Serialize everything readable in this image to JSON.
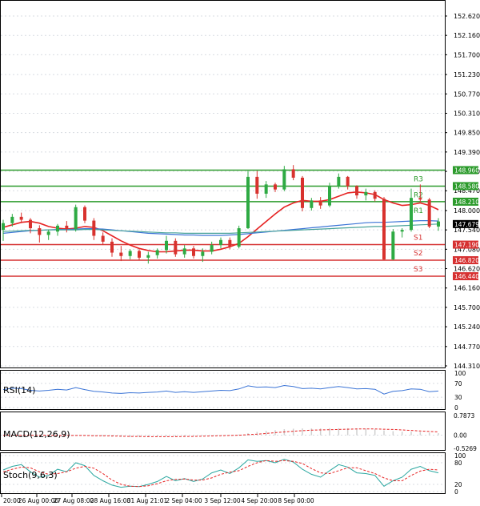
{
  "colors": {
    "bull": "#2eaa43",
    "bear": "#d8322e",
    "resistance": "#2c9b2c",
    "support": "#d63131",
    "ma_fast": "#e62222",
    "ma_mid": "#3b74d6",
    "ma_slow": "#49a39a",
    "rsi": "#3b74d6",
    "macd_signal": "#e62222",
    "macd_hist": "#cfcfcf",
    "stoch_k": "#2aa7a0",
    "stoch_d": "#e62222",
    "grid": "#d7dbe1",
    "price_tag_bg": "#000000",
    "price_tag_fg": "#ffffff"
  },
  "chart_data": [
    {
      "type": "candlestick",
      "ylim": [
        144.31,
        152.62
      ],
      "yticks": [
        "152.620",
        "152.160",
        "151.700",
        "151.230",
        "150.770",
        "150.310",
        "149.850",
        "149.390",
        "148.930",
        "148.470",
        "148.000",
        "147.540",
        "147.080",
        "146.620",
        "146.160",
        "145.700",
        "145.240",
        "144.770",
        "144.310"
      ],
      "xticks": [
        "20:00",
        "26 Aug 00:00",
        "27 Aug 08:00",
        "28 Aug 16:00",
        "31 Aug 21:01",
        "2 Sep 04:00",
        "3 Sep 12:00",
        "4 Sep 20:00",
        "8 Sep 00:00"
      ],
      "current_price": "147.679",
      "candles": [
        {
          "o": 147.54,
          "h": 147.78,
          "l": 147.28,
          "c": 147.7
        },
        {
          "o": 147.7,
          "h": 147.92,
          "l": 147.62,
          "c": 147.85
        },
        {
          "o": 147.85,
          "h": 147.95,
          "l": 147.7,
          "c": 147.78
        },
        {
          "o": 147.78,
          "h": 147.82,
          "l": 147.46,
          "c": 147.58
        },
        {
          "o": 147.58,
          "h": 147.65,
          "l": 147.24,
          "c": 147.42
        },
        {
          "o": 147.42,
          "h": 147.55,
          "l": 147.3,
          "c": 147.5
        },
        {
          "o": 147.5,
          "h": 147.68,
          "l": 147.4,
          "c": 147.64
        },
        {
          "o": 147.64,
          "h": 147.75,
          "l": 147.48,
          "c": 147.56
        },
        {
          "o": 147.56,
          "h": 148.14,
          "l": 147.5,
          "c": 148.08
        },
        {
          "o": 148.08,
          "h": 148.12,
          "l": 147.7,
          "c": 147.76
        },
        {
          "o": 147.76,
          "h": 147.82,
          "l": 147.3,
          "c": 147.4
        },
        {
          "o": 147.4,
          "h": 147.48,
          "l": 147.18,
          "c": 147.26
        },
        {
          "o": 147.26,
          "h": 147.34,
          "l": 146.9,
          "c": 147.0
        },
        {
          "o": 147.0,
          "h": 147.16,
          "l": 146.8,
          "c": 146.92
        },
        {
          "o": 146.92,
          "h": 147.08,
          "l": 146.84,
          "c": 147.04
        },
        {
          "o": 147.04,
          "h": 147.08,
          "l": 146.82,
          "c": 146.88
        },
        {
          "o": 146.88,
          "h": 147.02,
          "l": 146.74,
          "c": 146.94
        },
        {
          "o": 146.94,
          "h": 147.1,
          "l": 146.86,
          "c": 147.06
        },
        {
          "o": 147.06,
          "h": 147.4,
          "l": 146.98,
          "c": 147.28
        },
        {
          "o": 147.28,
          "h": 147.34,
          "l": 146.9,
          "c": 146.96
        },
        {
          "o": 146.96,
          "h": 147.18,
          "l": 146.88,
          "c": 147.1
        },
        {
          "o": 147.1,
          "h": 147.16,
          "l": 146.86,
          "c": 146.92
        },
        {
          "o": 146.92,
          "h": 147.1,
          "l": 146.78,
          "c": 147.02
        },
        {
          "o": 147.02,
          "h": 147.26,
          "l": 146.96,
          "c": 147.18
        },
        {
          "o": 147.18,
          "h": 147.36,
          "l": 147.1,
          "c": 147.3
        },
        {
          "o": 147.3,
          "h": 147.36,
          "l": 147.08,
          "c": 147.14
        },
        {
          "o": 147.14,
          "h": 147.64,
          "l": 147.1,
          "c": 147.58
        },
        {
          "o": 147.58,
          "h": 148.94,
          "l": 147.56,
          "c": 148.8
        },
        {
          "o": 148.8,
          "h": 148.94,
          "l": 148.28,
          "c": 148.4
        },
        {
          "o": 148.4,
          "h": 148.7,
          "l": 148.3,
          "c": 148.62
        },
        {
          "o": 148.62,
          "h": 148.66,
          "l": 148.44,
          "c": 148.5
        },
        {
          "o": 148.5,
          "h": 149.06,
          "l": 148.46,
          "c": 148.98
        },
        {
          "o": 148.98,
          "h": 149.08,
          "l": 148.72,
          "c": 148.78
        },
        {
          "o": 148.78,
          "h": 148.82,
          "l": 147.98,
          "c": 148.06
        },
        {
          "o": 148.06,
          "h": 148.3,
          "l": 148.0,
          "c": 148.24
        },
        {
          "o": 148.24,
          "h": 148.32,
          "l": 148.04,
          "c": 148.12
        },
        {
          "o": 148.12,
          "h": 148.66,
          "l": 148.08,
          "c": 148.58
        },
        {
          "o": 148.58,
          "h": 148.88,
          "l": 148.52,
          "c": 148.8
        },
        {
          "o": 148.8,
          "h": 148.82,
          "l": 148.5,
          "c": 148.58
        },
        {
          "o": 148.58,
          "h": 148.6,
          "l": 148.28,
          "c": 148.36
        },
        {
          "o": 148.36,
          "h": 148.52,
          "l": 148.24,
          "c": 148.44
        },
        {
          "o": 148.44,
          "h": 148.48,
          "l": 148.22,
          "c": 148.28
        },
        {
          "o": 148.28,
          "h": 148.32,
          "l": 146.82,
          "c": 146.84
        },
        {
          "o": 146.84,
          "h": 147.56,
          "l": 146.82,
          "c": 147.5
        },
        {
          "o": 147.5,
          "h": 147.58,
          "l": 147.36,
          "c": 147.54
        },
        {
          "o": 147.54,
          "h": 148.52,
          "l": 147.5,
          "c": 148.3
        },
        {
          "o": 148.3,
          "h": 148.62,
          "l": 148.2,
          "c": 148.26
        },
        {
          "o": 148.26,
          "h": 148.3,
          "l": 147.58,
          "c": 147.62
        },
        {
          "o": 147.62,
          "h": 147.82,
          "l": 147.52,
          "c": 147.74
        }
      ],
      "levels": [
        {
          "name": "R3",
          "value": 148.96,
          "kind": "resistance",
          "tag": "148.960"
        },
        {
          "name": "R2",
          "value": 148.58,
          "kind": "resistance",
          "tag": "148.580"
        },
        {
          "name": "R1",
          "value": 148.21,
          "kind": "resistance",
          "tag": "148.210"
        },
        {
          "name": "S1",
          "value": 147.19,
          "kind": "support",
          "tag": "147.190"
        },
        {
          "name": "S2",
          "value": 146.82,
          "kind": "support",
          "tag": "146.820"
        },
        {
          "name": "S3",
          "value": 146.44,
          "kind": "support",
          "tag": "146.440"
        }
      ],
      "moving_averages": [
        {
          "color_key": "ma_fast",
          "values": [
            147.6,
            147.66,
            147.72,
            147.74,
            147.7,
            147.62,
            147.58,
            147.56,
            147.58,
            147.62,
            147.6,
            147.52,
            147.4,
            147.28,
            147.18,
            147.1,
            147.05,
            147.02,
            147.02,
            147.04,
            147.06,
            147.06,
            147.04,
            147.04,
            147.08,
            147.14,
            147.22,
            147.38,
            147.56,
            147.74,
            147.92,
            148.08,
            148.18,
            148.24,
            148.22,
            148.22,
            148.26,
            148.34,
            148.42,
            148.44,
            148.42,
            148.38,
            148.26,
            148.18,
            148.12,
            148.14,
            148.18,
            148.12,
            148.02
          ]
        },
        {
          "color_key": "ma_mid",
          "values": [
            147.46,
            147.48,
            147.5,
            147.52,
            147.53,
            147.54,
            147.55,
            147.55,
            147.56,
            147.57,
            147.57,
            147.56,
            147.54,
            147.52,
            147.5,
            147.48,
            147.46,
            147.45,
            147.44,
            147.43,
            147.42,
            147.42,
            147.41,
            147.41,
            147.41,
            147.42,
            147.43,
            147.45,
            147.47,
            147.49,
            147.51,
            147.53,
            147.55,
            147.57,
            147.59,
            147.61,
            147.63,
            147.65,
            147.67,
            147.69,
            147.71,
            147.72,
            147.72,
            147.73,
            147.74,
            147.75,
            147.76,
            147.76,
            147.75
          ]
        },
        {
          "color_key": "ma_slow",
          "values": [
            147.5,
            147.51,
            147.52,
            147.53,
            147.53,
            147.54,
            147.54,
            147.54,
            147.54,
            147.55,
            147.55,
            147.54,
            147.53,
            147.52,
            147.51,
            147.5,
            147.49,
            147.48,
            147.47,
            147.47,
            147.46,
            147.46,
            147.46,
            147.46,
            147.46,
            147.46,
            147.47,
            147.48,
            147.49,
            147.5,
            147.51,
            147.52,
            147.53,
            147.54,
            147.55,
            147.56,
            147.57,
            147.58,
            147.59,
            147.6,
            147.61,
            147.62,
            147.62,
            147.63,
            147.64,
            147.65,
            147.66,
            147.67,
            147.68
          ]
        }
      ]
    },
    {
      "type": "line",
      "title": "RSI(14)",
      "ylim": [
        0,
        100
      ],
      "yticks": [
        "100",
        "70",
        "30",
        "0"
      ],
      "values": [
        52,
        56,
        55,
        50,
        48,
        50,
        53,
        51,
        58,
        52,
        47,
        45,
        42,
        41,
        43,
        42,
        44,
        45,
        48,
        44,
        46,
        44,
        46,
        48,
        50,
        49,
        54,
        63,
        59,
        60,
        58,
        64,
        61,
        55,
        56,
        54,
        58,
        61,
        58,
        54,
        55,
        53,
        39,
        47,
        49,
        54,
        53,
        46,
        48
      ]
    },
    {
      "type": "bar",
      "title": "MACD(12,26,9)",
      "ylim": [
        -0.5269,
        0.7873
      ],
      "yticks": [
        "0.7873",
        "0.00",
        "-0.5269"
      ],
      "histogram": [
        0.0,
        0.0,
        0.01,
        0.01,
        0.0,
        -0.01,
        -0.02,
        -0.02,
        -0.01,
        -0.02,
        -0.03,
        -0.04,
        -0.06,
        -0.07,
        -0.08,
        -0.08,
        -0.07,
        -0.06,
        -0.05,
        -0.05,
        -0.04,
        -0.03,
        -0.02,
        -0.01,
        0.0,
        0.01,
        0.03,
        0.08,
        0.13,
        0.17,
        0.2,
        0.24,
        0.26,
        0.27,
        0.27,
        0.27,
        0.28,
        0.28,
        0.28,
        0.27,
        0.26,
        0.24,
        0.19,
        0.16,
        0.14,
        0.14,
        0.13,
        0.1,
        0.08
      ],
      "signal": [
        0.0,
        0.0,
        0.0,
        0.0,
        0.0,
        0.0,
        -0.01,
        -0.01,
        -0.01,
        -0.01,
        -0.02,
        -0.02,
        -0.03,
        -0.04,
        -0.05,
        -0.05,
        -0.06,
        -0.06,
        -0.06,
        -0.06,
        -0.05,
        -0.05,
        -0.04,
        -0.03,
        -0.02,
        -0.01,
        0.0,
        0.02,
        0.04,
        0.07,
        0.1,
        0.13,
        0.16,
        0.18,
        0.2,
        0.21,
        0.22,
        0.23,
        0.24,
        0.25,
        0.25,
        0.25,
        0.24,
        0.23,
        0.21,
        0.19,
        0.17,
        0.15,
        0.13
      ]
    },
    {
      "type": "line",
      "title": "Stoch(9,6,3)",
      "ylim": [
        0,
        100
      ],
      "yticks": [
        "100",
        "80",
        "20",
        "0"
      ],
      "k": [
        60,
        70,
        75,
        55,
        40,
        45,
        62,
        55,
        80,
        72,
        45,
        30,
        18,
        12,
        15,
        14,
        20,
        28,
        42,
        30,
        36,
        28,
        35,
        52,
        60,
        50,
        66,
        88,
        84,
        86,
        80,
        90,
        82,
        62,
        48,
        40,
        58,
        75,
        68,
        52,
        50,
        45,
        15,
        30,
        40,
        62,
        70,
        58,
        52
      ],
      "d": [
        55,
        62,
        68,
        66,
        55,
        48,
        50,
        55,
        65,
        70,
        65,
        50,
        32,
        20,
        15,
        14,
        16,
        22,
        30,
        34,
        35,
        32,
        32,
        38,
        48,
        54,
        58,
        70,
        80,
        86,
        84,
        86,
        84,
        78,
        64,
        52,
        50,
        58,
        66,
        66,
        58,
        50,
        38,
        30,
        30,
        45,
        57,
        62,
        60
      ]
    }
  ]
}
